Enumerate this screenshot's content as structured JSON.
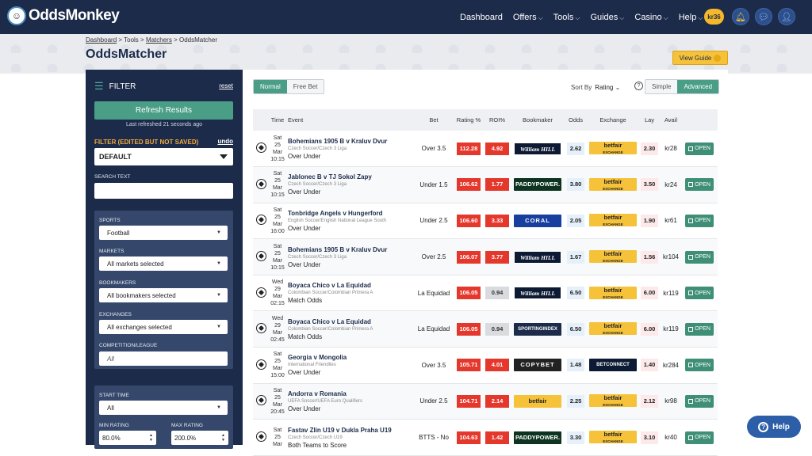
{
  "app": {
    "logo_text": "OddsMonkey"
  },
  "nav": {
    "items": [
      "Dashboard",
      "Offers",
      "Tools",
      "Guides",
      "Casino",
      "Help"
    ],
    "user_badge": "kr36"
  },
  "breadcrumb": {
    "parts": [
      "Dashboard",
      "Tools",
      "Matchers",
      "OddsMatcher"
    ],
    "sep": " > "
  },
  "page": {
    "title": "OddsMatcher",
    "view_guide": "View Guide"
  },
  "sidebar": {
    "filter_title": "FILTER",
    "reset": "reset",
    "refresh": "Refresh Results",
    "last_refreshed": "Last refreshed 21 seconds ago",
    "filter_status": "FILTER (EDITED BUT NOT SAVED)",
    "undo": "undo",
    "selected_filter": "DEFAULT",
    "search_label": "SEARCH TEXT",
    "search_value": "",
    "sports_label": "SPORTS",
    "sports_value": "Football",
    "markets_label": "MARKETS",
    "markets_value": "All markets selected",
    "bookmakers_label": "BOOKMAKERS",
    "bookmakers_value": "All bookmakers selected",
    "exchanges_label": "EXCHANGES",
    "exchanges_value": "All exchanges selected",
    "competition_label": "COMPETITION/LEAGUE",
    "competition_placeholder": "All",
    "start_time_label": "START TIME",
    "start_time_value": "All",
    "min_rating_label": "MIN RATING",
    "min_rating_value": "80.0%",
    "max_rating_label": "MAX RATING",
    "max_rating_value": "200.0%"
  },
  "toolbar": {
    "mode_tabs": [
      "Normal",
      "Free Bet"
    ],
    "sort_label": "Sort By",
    "sort_value": "Rating",
    "view_tabs": [
      "Simple",
      "Advanced"
    ]
  },
  "table": {
    "headers": {
      "time": "Time",
      "event": "Event",
      "bet": "Bet",
      "rating": "Rating %",
      "roi": "ROI%",
      "bookmaker": "Bookmaker",
      "odds": "Odds",
      "exchange": "Exchange",
      "lay": "Lay",
      "avail": "Avail"
    },
    "open_label": "OPEN",
    "rows": [
      {
        "time": [
          "Sat",
          "25",
          "Mar",
          "10:15"
        ],
        "event": "Bohemians 1905 B v Kraluv Dvur",
        "comp": "Czech Soccer/Czech 3 Liga",
        "market": "Over Under",
        "bet": "Over 3.5",
        "rating": "112.28",
        "roi": "4.92",
        "roi_grey": false,
        "bookmaker": "William HILL",
        "bm_style": "wh",
        "odds": "2.62",
        "exchange": "betfair",
        "ex_sub": "EXCHANGE",
        "ex_style": "bf",
        "lay": "2.30",
        "avail": "kr28"
      },
      {
        "time": [
          "Sat",
          "25",
          "Mar",
          "10:15"
        ],
        "event": "Jablonec B v TJ Sokol Zapy",
        "comp": "Czech Soccer/Czech 3 Liga",
        "market": "Over Under",
        "bet": "Under 1.5",
        "rating": "106.62",
        "roi": "1.77",
        "roi_grey": false,
        "bookmaker": "PADDYPOWER.",
        "bm_style": "pp",
        "odds": "3.80",
        "exchange": "betfair",
        "ex_sub": "EXCHANGE",
        "ex_style": "bf",
        "lay": "3.50",
        "avail": "kr24"
      },
      {
        "time": [
          "Sat",
          "25",
          "Mar",
          "16:00"
        ],
        "event": "Tonbridge Angels v Hungerford",
        "comp": "English Soccer/English National League South",
        "market": "Over Under",
        "bet": "Under 2.5",
        "rating": "106.60",
        "roi": "3.33",
        "roi_grey": false,
        "bookmaker": "CORAL",
        "bm_style": "coral",
        "odds": "2.05",
        "exchange": "betfair",
        "ex_sub": "EXCHANGE",
        "ex_style": "bf",
        "lay": "1.90",
        "avail": "kr61"
      },
      {
        "time": [
          "Sat",
          "25",
          "Mar",
          "10:15"
        ],
        "event": "Bohemians 1905 B v Kraluv Dvur",
        "comp": "Czech Soccer/Czech 3 Liga",
        "market": "Over Under",
        "bet": "Over 2.5",
        "rating": "106.07",
        "roi": "3.77",
        "roi_grey": false,
        "bookmaker": "William HILL",
        "bm_style": "wh",
        "odds": "1.67",
        "exchange": "betfair",
        "ex_sub": "EXCHANGE",
        "ex_style": "bf",
        "lay": "1.56",
        "avail": "kr104"
      },
      {
        "time": [
          "Wed",
          "29",
          "Mar",
          "02:15"
        ],
        "event": "Boyaca Chico v La Equidad",
        "comp": "Colombian Soccer/Colombian Primera A",
        "market": "Match Odds",
        "bet": "La Equidad",
        "rating": "106.05",
        "roi": "0.94",
        "roi_grey": true,
        "bookmaker": "William HILL",
        "bm_style": "wh",
        "odds": "6.50",
        "exchange": "betfair",
        "ex_sub": "EXCHANGE",
        "ex_style": "bf",
        "lay": "6.00",
        "avail": "kr119"
      },
      {
        "time": [
          "Wed",
          "29",
          "Mar",
          "02:45"
        ],
        "event": "Boyaca Chico v La Equidad",
        "comp": "Colombian Soccer/Colombian Primera A",
        "market": "Match Odds",
        "bet": "La Equidad",
        "rating": "106.05",
        "roi": "0.94",
        "roi_grey": true,
        "bookmaker": "SPORTINGINDEX",
        "bm_style": "si",
        "odds": "6.50",
        "exchange": "betfair",
        "ex_sub": "EXCHANGE",
        "ex_style": "bf",
        "lay": "6.00",
        "avail": "kr119"
      },
      {
        "time": [
          "Sat",
          "25",
          "Mar",
          "15:00"
        ],
        "event": "Georgia v Mongolia",
        "comp": "International Friendlies",
        "market": "Over Under",
        "bet": "Over 3.5",
        "rating": "105.71",
        "roi": "4.01",
        "roi_grey": false,
        "bookmaker": "COPYBET",
        "bm_style": "cb",
        "odds": "1.48",
        "exchange": "BETCONNECT",
        "ex_sub": "",
        "ex_style": "bc",
        "lay": "1.40",
        "avail": "kr284"
      },
      {
        "time": [
          "Sat",
          "25",
          "Mar",
          "20:45"
        ],
        "event": "Andorra v Romania",
        "comp": "UEFA Soccer/UEFA Euro Qualifiers",
        "market": "Over Under",
        "bet": "Under 2.5",
        "rating": "104.71",
        "roi": "2.14",
        "roi_grey": false,
        "bookmaker": "betfair",
        "bm_style": "bf",
        "odds": "2.25",
        "exchange": "betfair",
        "ex_sub": "EXCHANGE",
        "ex_style": "bf",
        "lay": "2.12",
        "avail": "kr98"
      },
      {
        "time": [
          "Sat",
          "25",
          "Mar",
          ""
        ],
        "event": "Fastav Zlin U19 v Dukla Praha U19",
        "comp": "Czech Soccer/Czech U19",
        "market": "Both Teams to Score",
        "bet": "BTTS - No",
        "rating": "104.63",
        "roi": "1.42",
        "roi_grey": false,
        "bookmaker": "PADDYPOWER.",
        "bm_style": "pp",
        "odds": "3.30",
        "exchange": "betfair",
        "ex_sub": "EXCHANGE",
        "ex_style": "bf",
        "lay": "3.10",
        "avail": "kr40"
      }
    ]
  },
  "help_button": "Help",
  "colors": {
    "navy": "#1c2b4a",
    "teal": "#4a9e86",
    "red": "#e4382d",
    "gold": "#f5c23a"
  }
}
